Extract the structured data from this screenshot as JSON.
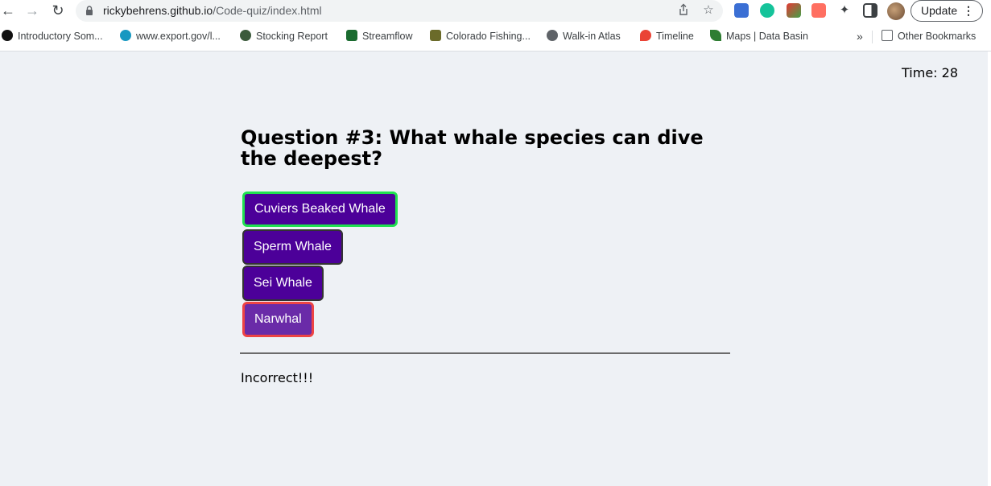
{
  "browser": {
    "url_host": "rickybehrens.github.io",
    "url_path": "/Code-quiz/index.html",
    "update_label": "Update",
    "bookmarks": [
      {
        "label": "Introductory Som...",
        "icon": "github-icon",
        "color": "#111111"
      },
      {
        "label": "www.export.gov/l...",
        "icon": "salesforce-cloud-icon",
        "color": "#1798c1"
      },
      {
        "label": "Stocking Report",
        "icon": "state-seal-icon",
        "color": "#3b5a3b"
      },
      {
        "label": "Streamflow",
        "icon": "streamflow-icon",
        "color": "#1a6b2f"
      },
      {
        "label": "Colorado Fishing...",
        "icon": "wildlife-icon",
        "color": "#6b6b2a"
      },
      {
        "label": "Walk-in Atlas",
        "icon": "globe-icon",
        "color": "#5f6368"
      },
      {
        "label": "Timeline",
        "icon": "maps-pin-icon",
        "color": "#ea4335"
      },
      {
        "label": "Maps | Data Basin",
        "icon": "leaf-icon",
        "color": "#2e7d32"
      }
    ],
    "overflow_label": "»",
    "other_bookmarks_label": "Other Bookmarks"
  },
  "quiz": {
    "timer": "Time: 28",
    "question": "Question #3: What whale species can dive the deepest?",
    "answers": [
      {
        "label": "Cuviers Beaked Whale",
        "state": "correct"
      },
      {
        "label": "Sperm Whale",
        "state": "default"
      },
      {
        "label": "Sei Whale",
        "state": "default"
      },
      {
        "label": "Narwhal",
        "state": "wrong"
      }
    ],
    "feedback": "Incorrect!!!"
  },
  "colors": {
    "page_bg": "#eef1f5",
    "button_bg": "#4c0099",
    "correct_border": "#20e050",
    "wrong_border": "#ee4444"
  }
}
